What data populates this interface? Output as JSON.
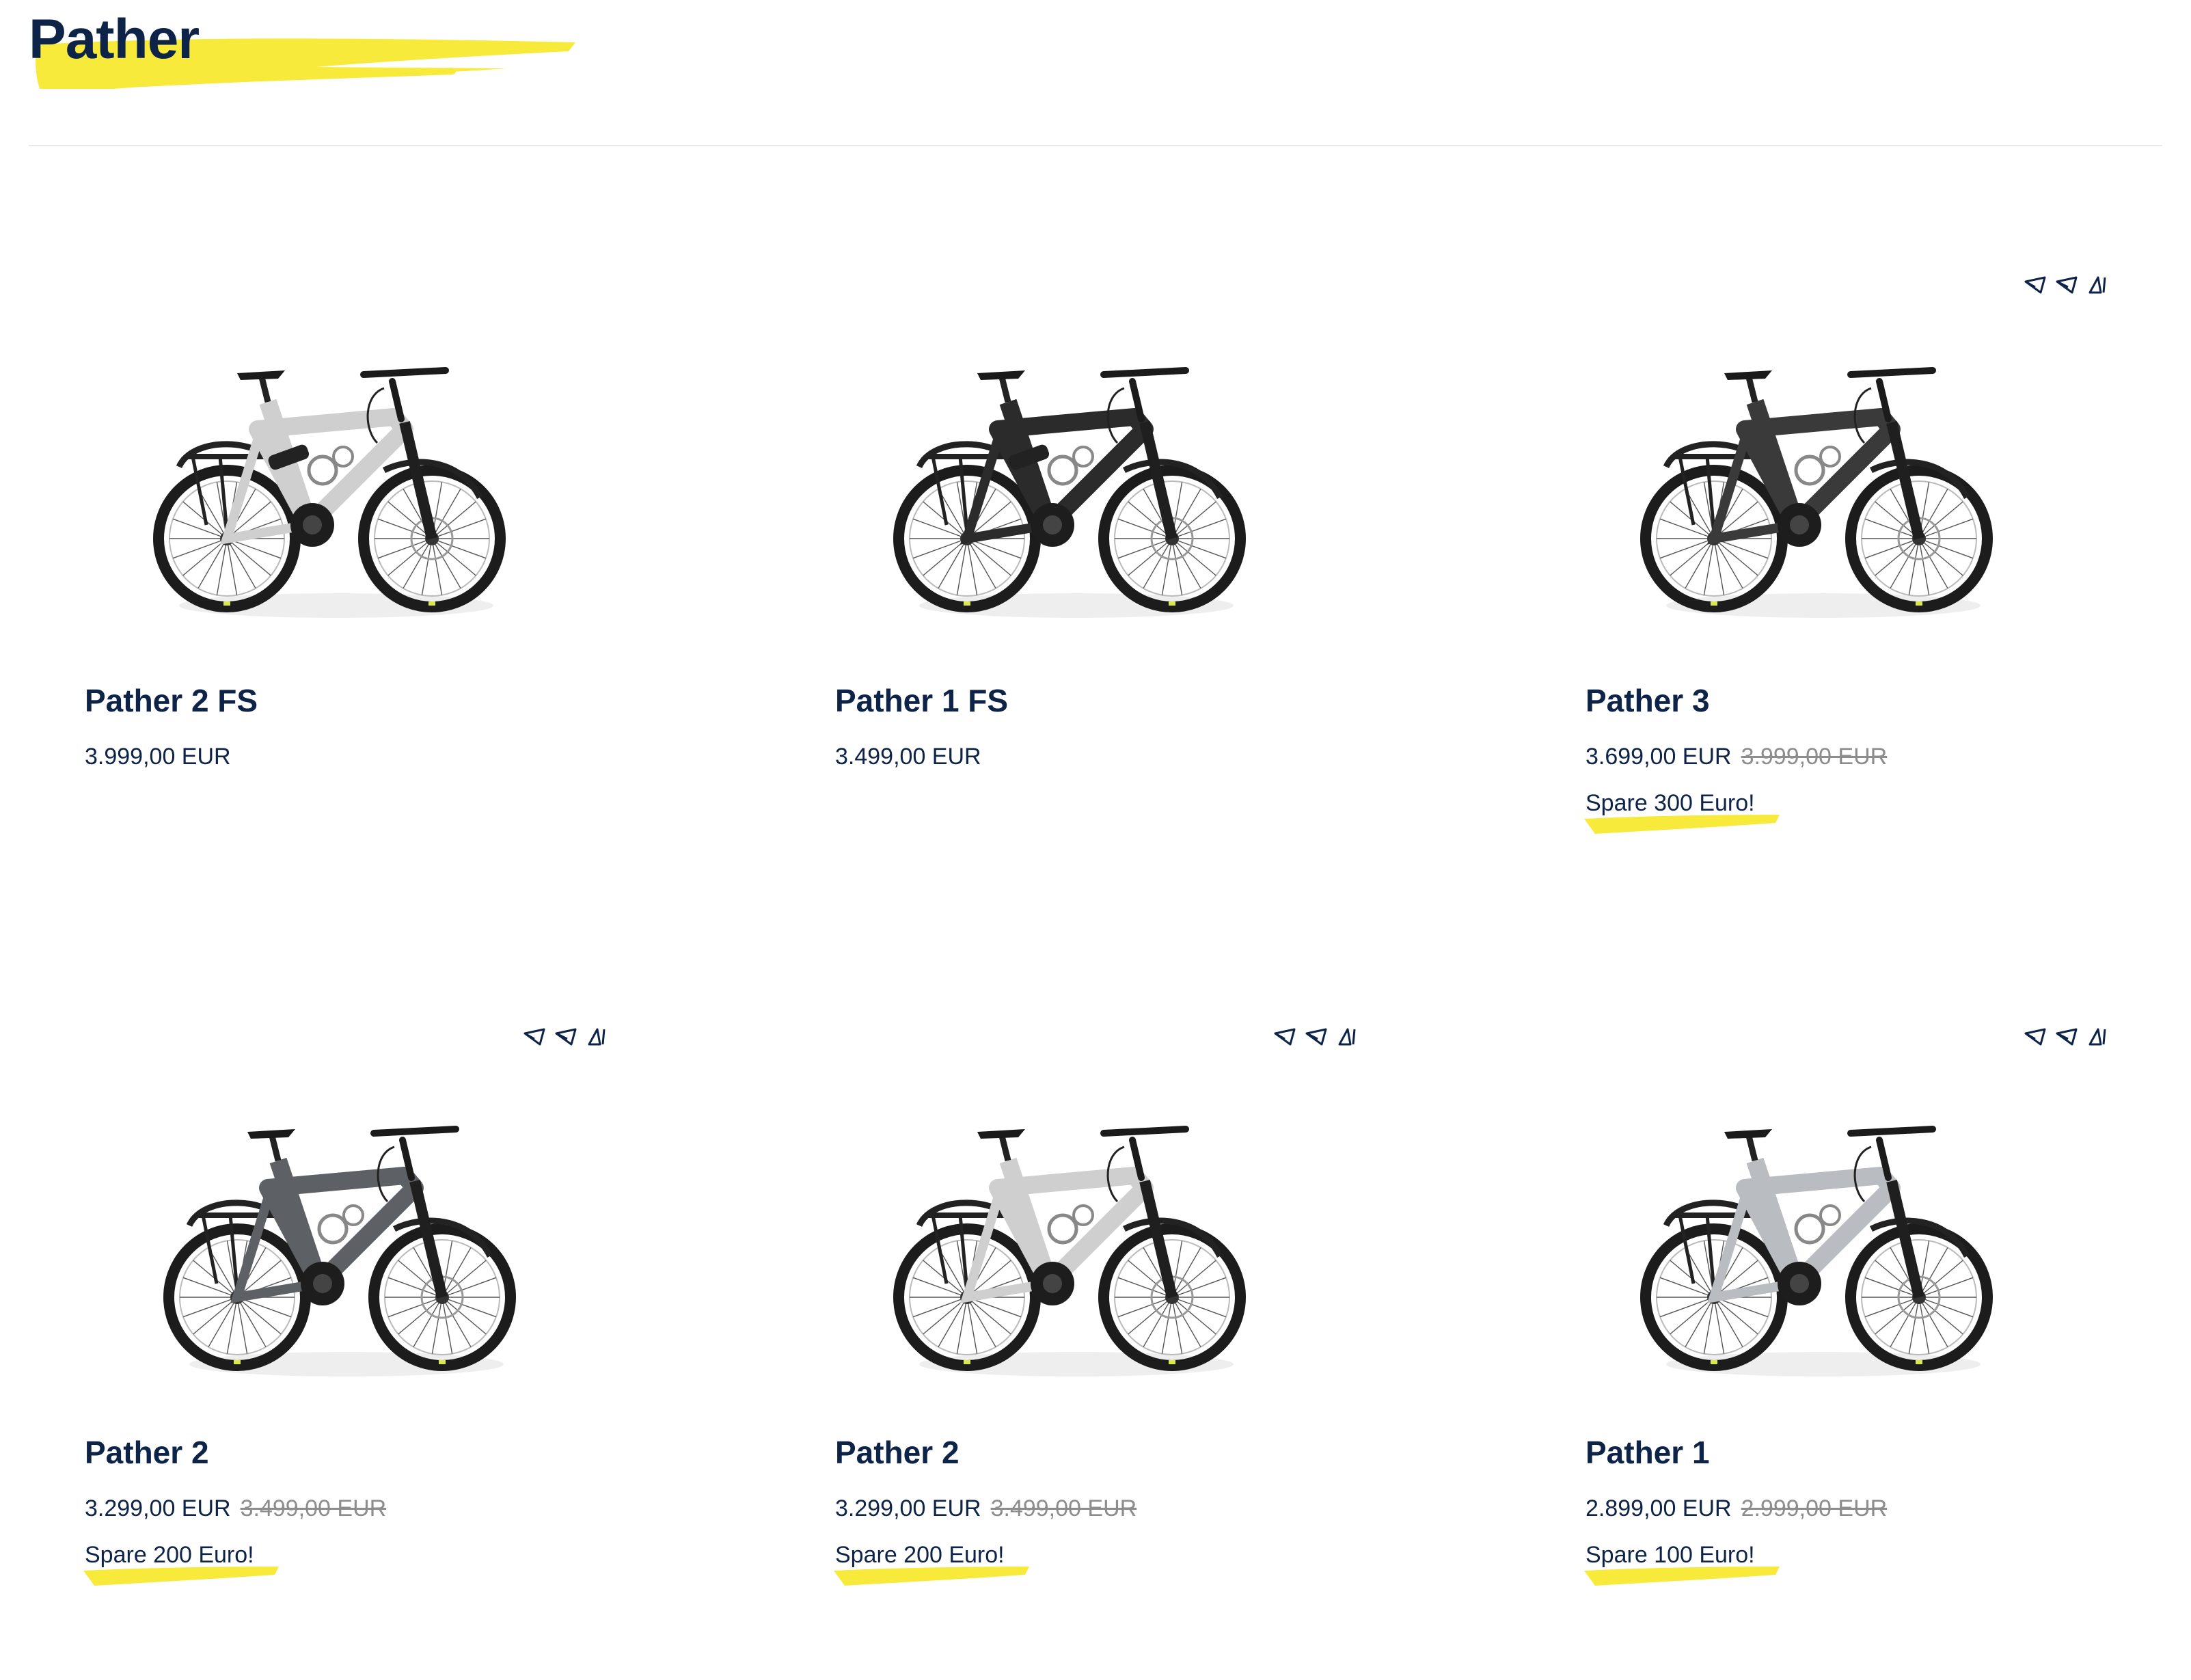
{
  "page": {
    "title": "Pather"
  },
  "colors": {
    "accent_yellow": "#f7ea3b",
    "navy": "#0e2348",
    "strike_gray": "#8d8d8d",
    "divider": "#e8e8e8"
  },
  "products": [
    {
      "name": "Pather 2 FS",
      "price": "3.999,00 EUR",
      "old_price": "",
      "savings": "",
      "badge": false,
      "frame": "full-suspension",
      "color": "light-gray"
    },
    {
      "name": "Pather 1 FS",
      "price": "3.499,00 EUR",
      "old_price": "",
      "savings": "",
      "badge": false,
      "frame": "full-suspension",
      "color": "black"
    },
    {
      "name": "Pather 3",
      "price": "3.699,00 EUR",
      "old_price": "3.999,00 EUR",
      "savings": "Spare 300 Euro!",
      "badge": true,
      "frame": "hardtail",
      "color": "dark-gray"
    },
    {
      "name": "Pather 2",
      "price": "3.299,00 EUR",
      "old_price": "3.499,00 EUR",
      "savings": "Spare 200 Euro!",
      "badge": true,
      "frame": "hardtail",
      "color": "slate"
    },
    {
      "name": "Pather 2",
      "price": "3.299,00 EUR",
      "old_price": "3.499,00 EUR",
      "savings": "Spare 200 Euro!",
      "badge": true,
      "frame": "hardtail",
      "color": "light-gray"
    },
    {
      "name": "Pather 1",
      "price": "2.899,00 EUR",
      "old_price": "2.999,00 EUR",
      "savings": "Spare 100 Euro!",
      "badge": true,
      "frame": "hardtail",
      "color": "silver"
    }
  ],
  "icons": {
    "badge": "frame-type-icons",
    "brush": "yellow-brush-underline",
    "bike": "e-bike-image"
  }
}
